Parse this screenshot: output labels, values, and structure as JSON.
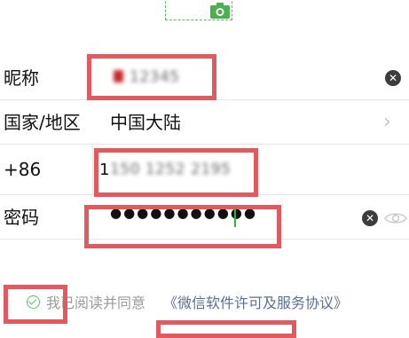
{
  "header": {
    "avatar_icon": "camera-icon"
  },
  "form": {
    "nickname": {
      "label": "昵称",
      "value": "12345"
    },
    "region": {
      "label": "国家/地区",
      "value": "中国大陆"
    },
    "phone": {
      "code": "+86",
      "value": "150 1252 2195"
    },
    "password": {
      "label": "密码",
      "value": "●●●●●●●●●●●"
    }
  },
  "agreement": {
    "text": "我已阅读并同意",
    "link": "《微信软件许可及服务协议》"
  },
  "colors": {
    "highlight": "#e35a5e",
    "accent": "#2bb744",
    "link": "#5b6f93"
  }
}
